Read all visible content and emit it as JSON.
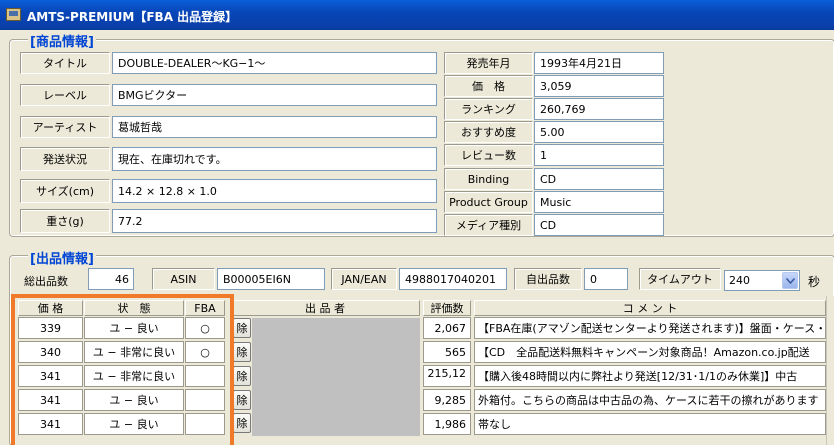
{
  "window": {
    "title": "AMTS-PREMIUM【FBA 出品登録】"
  },
  "product": {
    "section_title": "[商品情報]",
    "left": [
      {
        "label": "タイトル",
        "value": "DOUBLE-DEALER〜KG−1〜"
      },
      {
        "label": "レーベル",
        "value": "BMGビクター"
      },
      {
        "label": "アーティスト",
        "value": "葛城哲哉"
      },
      {
        "label": "発送状況",
        "value": "現在、在庫切れです。"
      },
      {
        "label": "サイズ(cm)",
        "value": "14.2 × 12.8 × 1.0"
      },
      {
        "label": "重さ(g)",
        "value": "77.2"
      }
    ],
    "right": [
      {
        "label": "発売年月",
        "value": "1993年4月21日"
      },
      {
        "label": "価　格",
        "value": "3,059"
      },
      {
        "label": "ランキング",
        "value": "260,769"
      },
      {
        "label": "おすすめ度",
        "value": "5.00"
      },
      {
        "label": "レビュー数",
        "value": "1"
      },
      {
        "label": "Binding",
        "value": "CD"
      },
      {
        "label": "Product Group",
        "value": "Music"
      },
      {
        "label": "メディア種別",
        "value": "CD"
      }
    ]
  },
  "listing": {
    "section_title": "[出品情報]",
    "total_label": "総出品数",
    "total_value": "46",
    "asin_label": "ASIN",
    "asin_value": "B00005EI6N",
    "jan_label": "JAN/EAN",
    "jan_value": "4988017040201",
    "self_label": "自出品数",
    "self_value": "0",
    "timeout_label": "タイムアウト",
    "timeout_value": "240",
    "timeout_unit": "秒"
  },
  "table": {
    "headers": {
      "price": "価 格",
      "condition": "状　態",
      "fba": "FBA",
      "seller": "出 品 者",
      "rating": "評価数",
      "comment": "コ メ ン ト"
    },
    "delete_label": "除",
    "rows": [
      {
        "price": "339",
        "condition": "ユ − 良い",
        "fba": "○",
        "rating": "2,067",
        "comment": "【FBA在庫(アマゾン配送センターより発送されます)】盤面・ケース・ジ"
      },
      {
        "price": "340",
        "condition": "ユ − 非常に良い",
        "fba": "○",
        "rating": "565",
        "comment": "【CD　全品配送料無料キャンペーン対象商品！Amazon.co.jp配送"
      },
      {
        "price": "341",
        "condition": "ユ − 非常に良い",
        "fba": "",
        "rating": "215,12",
        "comment": "【購入後48時間以内に弊社より発送[12/31･1/1のみ休業]】中古"
      },
      {
        "price": "341",
        "condition": "ユ − 良い",
        "fba": "",
        "rating": "9,285",
        "comment": "外箱付。こちらの商品は中古品の為、ケースに若干の擦れがあります"
      },
      {
        "price": "341",
        "condition": "ユ − 良い",
        "fba": "",
        "rating": "1,986",
        "comment": "帯なし"
      }
    ]
  }
}
